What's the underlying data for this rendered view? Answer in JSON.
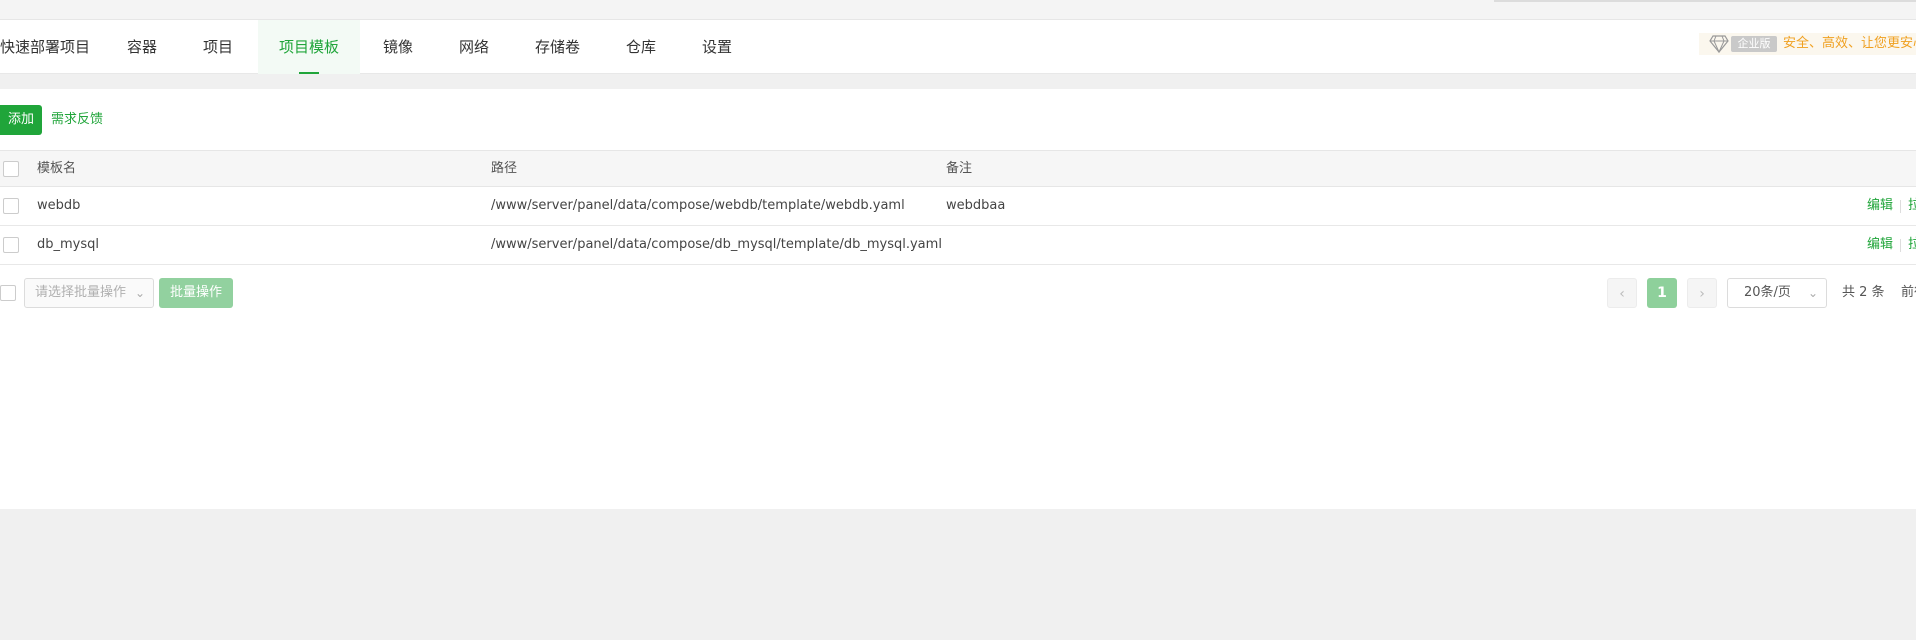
{
  "tabs": [
    {
      "label": "快速部署项目",
      "active": false
    },
    {
      "label": "容器",
      "active": false
    },
    {
      "label": "项目",
      "active": false
    },
    {
      "label": "项目模板",
      "active": true
    },
    {
      "label": "镜像",
      "active": false
    },
    {
      "label": "网络",
      "active": false
    },
    {
      "label": "存储卷",
      "active": false
    },
    {
      "label": "仓库",
      "active": false
    },
    {
      "label": "设置",
      "active": false
    }
  ],
  "enterprise": {
    "badge": "企业版",
    "slogan": "安全、高效、让您更安心"
  },
  "toolbar": {
    "add_label": "添加",
    "feedback_label": "需求反馈"
  },
  "table": {
    "columns": {
      "name": "模板名",
      "path": "路径",
      "remark": "备注"
    },
    "rows": [
      {
        "name": "webdb",
        "path": "/www/server/panel/data/compose/webdb/template/webdb.yaml",
        "remark": "webdbaa",
        "edit": "编辑",
        "more": "拉"
      },
      {
        "name": "db_mysql",
        "path": "/www/server/panel/data/compose/db_mysql/template/db_mysql.yaml",
        "remark": "",
        "edit": "编辑",
        "more": "拉"
      }
    ]
  },
  "batch": {
    "select_placeholder": "请选择批量操作",
    "button_label": "批量操作"
  },
  "pagination": {
    "prev": "‹",
    "current": "1",
    "next": "›",
    "page_size": "20条/页",
    "total": "共 2 条",
    "jump": "前往"
  },
  "colors": {
    "accent": "#20a53a",
    "enterprise": "#f0a020"
  }
}
